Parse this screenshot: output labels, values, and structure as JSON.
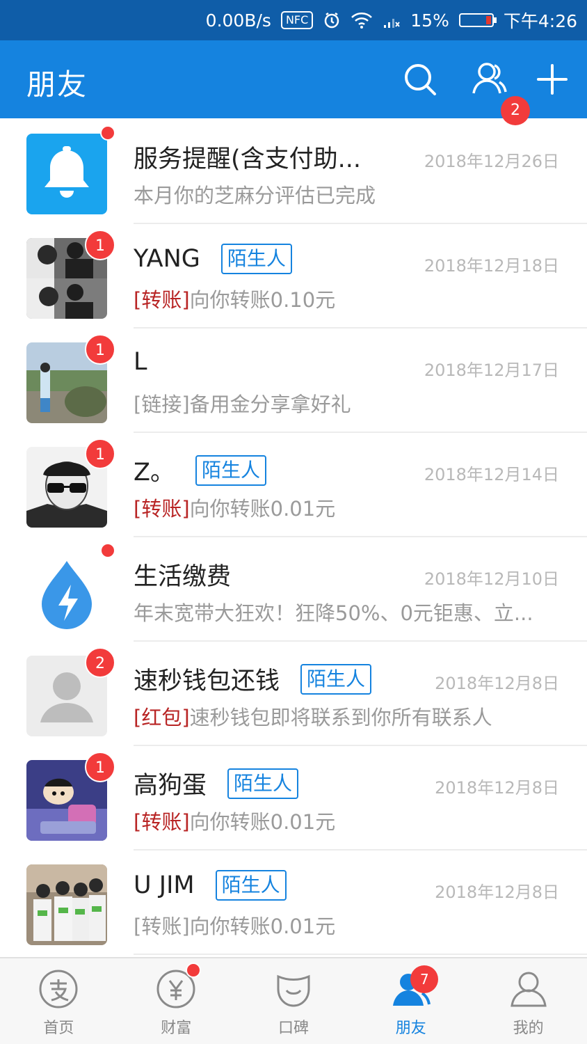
{
  "status_bar": {
    "speed": "0.00B/s",
    "nfc": "NFC",
    "battery": "15%",
    "time": "下午4:26"
  },
  "header": {
    "title": "朋友",
    "contacts_badge": "2"
  },
  "conversations": [
    {
      "name": "服务提醒(含支付助...",
      "tag": "",
      "date": "2018年12月26日",
      "msg_kind": "",
      "msg_text": "本月你的芝麻分评估已完成",
      "badge": "dot"
    },
    {
      "name": "YANG",
      "tag": "陌生人",
      "date": "2018年12月18日",
      "msg_kind": "[转账]",
      "msg_text": "向你转账0.10元",
      "badge": "1"
    },
    {
      "name": "L",
      "tag": "",
      "date": "2018年12月17日",
      "msg_kind": "",
      "msg_text": "[链接]备用金分享拿好礼",
      "badge": "1"
    },
    {
      "name": "Z。",
      "tag": "陌生人",
      "date": "2018年12月14日",
      "msg_kind": "[转账]",
      "msg_text": "向你转账0.01元",
      "badge": "1"
    },
    {
      "name": "生活缴费",
      "tag": "",
      "date": "2018年12月10日",
      "msg_kind": "",
      "msg_text": "年末宽带大狂欢！狂降50%、0元钜惠、立...",
      "badge": "dot"
    },
    {
      "name": "速秒钱包还钱",
      "tag": "陌生人",
      "date": "2018年12月8日",
      "msg_kind": "[红包]",
      "msg_text": "速秒钱包即将联系到你所有联系人",
      "badge": "2"
    },
    {
      "name": "高狗蛋",
      "tag": "陌生人",
      "date": "2018年12月8日",
      "msg_kind": "[转账]",
      "msg_text": "向你转账0.01元",
      "badge": "1"
    },
    {
      "name": "U JIM",
      "tag": "陌生人",
      "date": "2018年12月8日",
      "msg_kind": "[转账]",
      "msg_text": "向你转账0.01元",
      "badge": ""
    }
  ],
  "bottom_nav": [
    {
      "label": "首页",
      "icon": "alipay-home-icon"
    },
    {
      "label": "财富",
      "icon": "yuan-icon"
    },
    {
      "label": "口碑",
      "icon": "koubei-icon"
    },
    {
      "label": "朋友",
      "icon": "friends-icon",
      "active": true
    },
    {
      "label": "我的",
      "icon": "profile-icon"
    }
  ],
  "bottom_badges": {
    "friends": "7"
  },
  "colors": {
    "brand_blue": "#1583df",
    "status_bar": "#0f5da8",
    "badge_red": "#f23b3b",
    "transfer_red": "#b82424"
  }
}
